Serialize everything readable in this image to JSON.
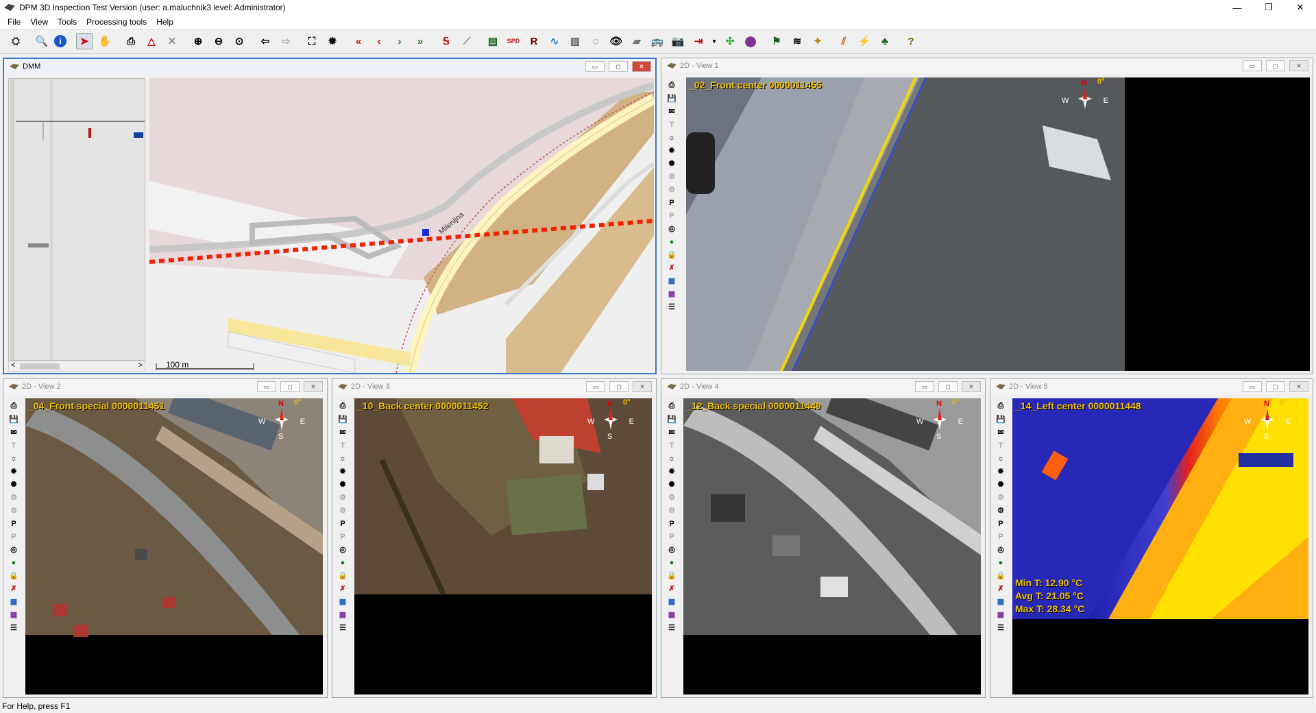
{
  "app": {
    "title": "DPM 3D Inspection Test Version (user: a.maluchnik3 level: Administrator)"
  },
  "window_controls": {
    "minimize": "—",
    "maximize": "❐",
    "close": "✕"
  },
  "menu": [
    "File",
    "View",
    "Tools",
    "Processing tools",
    "Help"
  ],
  "toolbar_icons": [
    "open-map-icon",
    "zoom-search-icon",
    "info-icon",
    "select-arrow-icon",
    "pan-hand-icon",
    "print-icon",
    "measure-triangle-icon",
    "cross-icon",
    "zoom-in-icon",
    "zoom-out-icon",
    "zoom-fit-icon",
    "back-icon",
    "forward-icon",
    "full-extent-icon",
    "brightness-icon",
    "first-icon",
    "previous-icon",
    "next-icon",
    "last-icon",
    "route-icon",
    "line-tool-icon",
    "profile-icon",
    "spd-icon",
    "report-icon",
    "curve-icon",
    "tower-icon",
    "lasso-icon",
    "eye-icon",
    "stamp-icon",
    "vehicle-icon",
    "camera-icon",
    "export-icon",
    "dropdown-icon",
    "vegetation-icon",
    "layer-icon",
    "map-flag-icon",
    "layers-icon",
    "wand-icon",
    "rainbow-icon",
    "hazard-icon",
    "tree-icon",
    "help-icon"
  ],
  "dmm": {
    "title": "DMM",
    "street": "Milenijna",
    "scale": "100 m",
    "scroll_left": "<",
    "scroll_right": ">"
  },
  "views": [
    {
      "window": "2D - View 1",
      "label": "_02_Front center 0000011455",
      "degrees": "0°",
      "north": "N",
      "west": "W",
      "east": "E",
      "south": ""
    },
    {
      "window": "2D - View 2",
      "label": "_04_Front special 0000011451",
      "degrees": "0°",
      "north": "N",
      "west": "W",
      "east": "E",
      "south": "S"
    },
    {
      "window": "2D - View 3",
      "label": "_10_Back center 0000011452",
      "degrees": "0°",
      "north": "N",
      "west": "W",
      "east": "E",
      "south": "S"
    },
    {
      "window": "2D - View 4",
      "label": "_12_Back special 0000011449",
      "degrees": "0°",
      "north": "N",
      "west": "W",
      "east": "E",
      "south": "S"
    },
    {
      "window": "2D - View 5",
      "label": "_14_Left center 0000011448",
      "degrees": "0°",
      "north": "N",
      "west": "W",
      "east": "E",
      "south": "S"
    }
  ],
  "thermal": {
    "min": "Min T: 12.90 °C",
    "avg": "Avg T: 21.05 °C",
    "max": "Max T: 28.34 °C"
  },
  "status": {
    "text": "For Help, press F1"
  },
  "colors": {
    "accent": "#3c78c8",
    "label": "#f0c000",
    "route": "#ee2200"
  }
}
